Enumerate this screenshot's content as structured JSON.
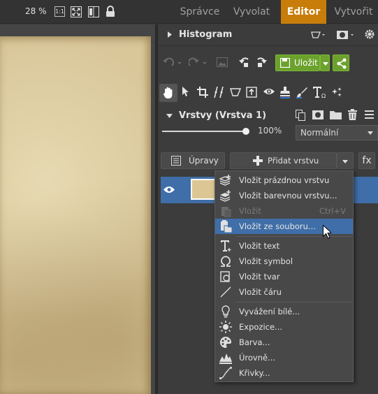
{
  "topbar": {
    "zoom": "28 %",
    "zoom_1to1": "1:1",
    "tabs": [
      {
        "label": "Správce",
        "active": false
      },
      {
        "label": "Vyvolat",
        "active": false
      },
      {
        "label": "Editor",
        "active": true
      },
      {
        "label": "Vytvořit",
        "active": false
      }
    ],
    "accent_color": "#c87d0a"
  },
  "histogram": {
    "title": "Histogram"
  },
  "toolbar": {
    "save_label": "Uložit"
  },
  "layers": {
    "title": "Vrstvy (Vrstva 1)",
    "opacity": "100%",
    "opacity_value": 1.0,
    "blend_mode": "Normální",
    "adjust_label": "Úpravy",
    "add_layer_label": "Přidat vrstvu",
    "fx_label": "fx"
  },
  "menu": {
    "items": [
      {
        "label": "Vložit prázdnou vrstvu",
        "icon": "layers-plus-icon"
      },
      {
        "label": "Vložit barevnou vrstvu...",
        "icon": "layers-color-icon"
      },
      {
        "label": "Vložit",
        "shortcut": "Ctrl+V",
        "icon": "paste-icon",
        "disabled": true
      },
      {
        "label": "Vložit ze souboru...",
        "icon": "paste-file-icon",
        "hover": true
      },
      {
        "label": "Vložit text",
        "icon": "text-icon"
      },
      {
        "label": "Vložit symbol",
        "icon": "omega-icon"
      },
      {
        "label": "Vložit tvar",
        "icon": "shape-icon"
      },
      {
        "label": "Vložit čáru",
        "icon": "line-icon"
      },
      {
        "label": "Vyvážení bílé...",
        "icon": "bulb-icon"
      },
      {
        "label": "Expozice...",
        "icon": "sun-icon"
      },
      {
        "label": "Barva...",
        "icon": "palette-icon"
      },
      {
        "label": "Úrovně...",
        "icon": "levels-icon"
      },
      {
        "label": "Křivky...",
        "icon": "curve-icon"
      }
    ]
  }
}
